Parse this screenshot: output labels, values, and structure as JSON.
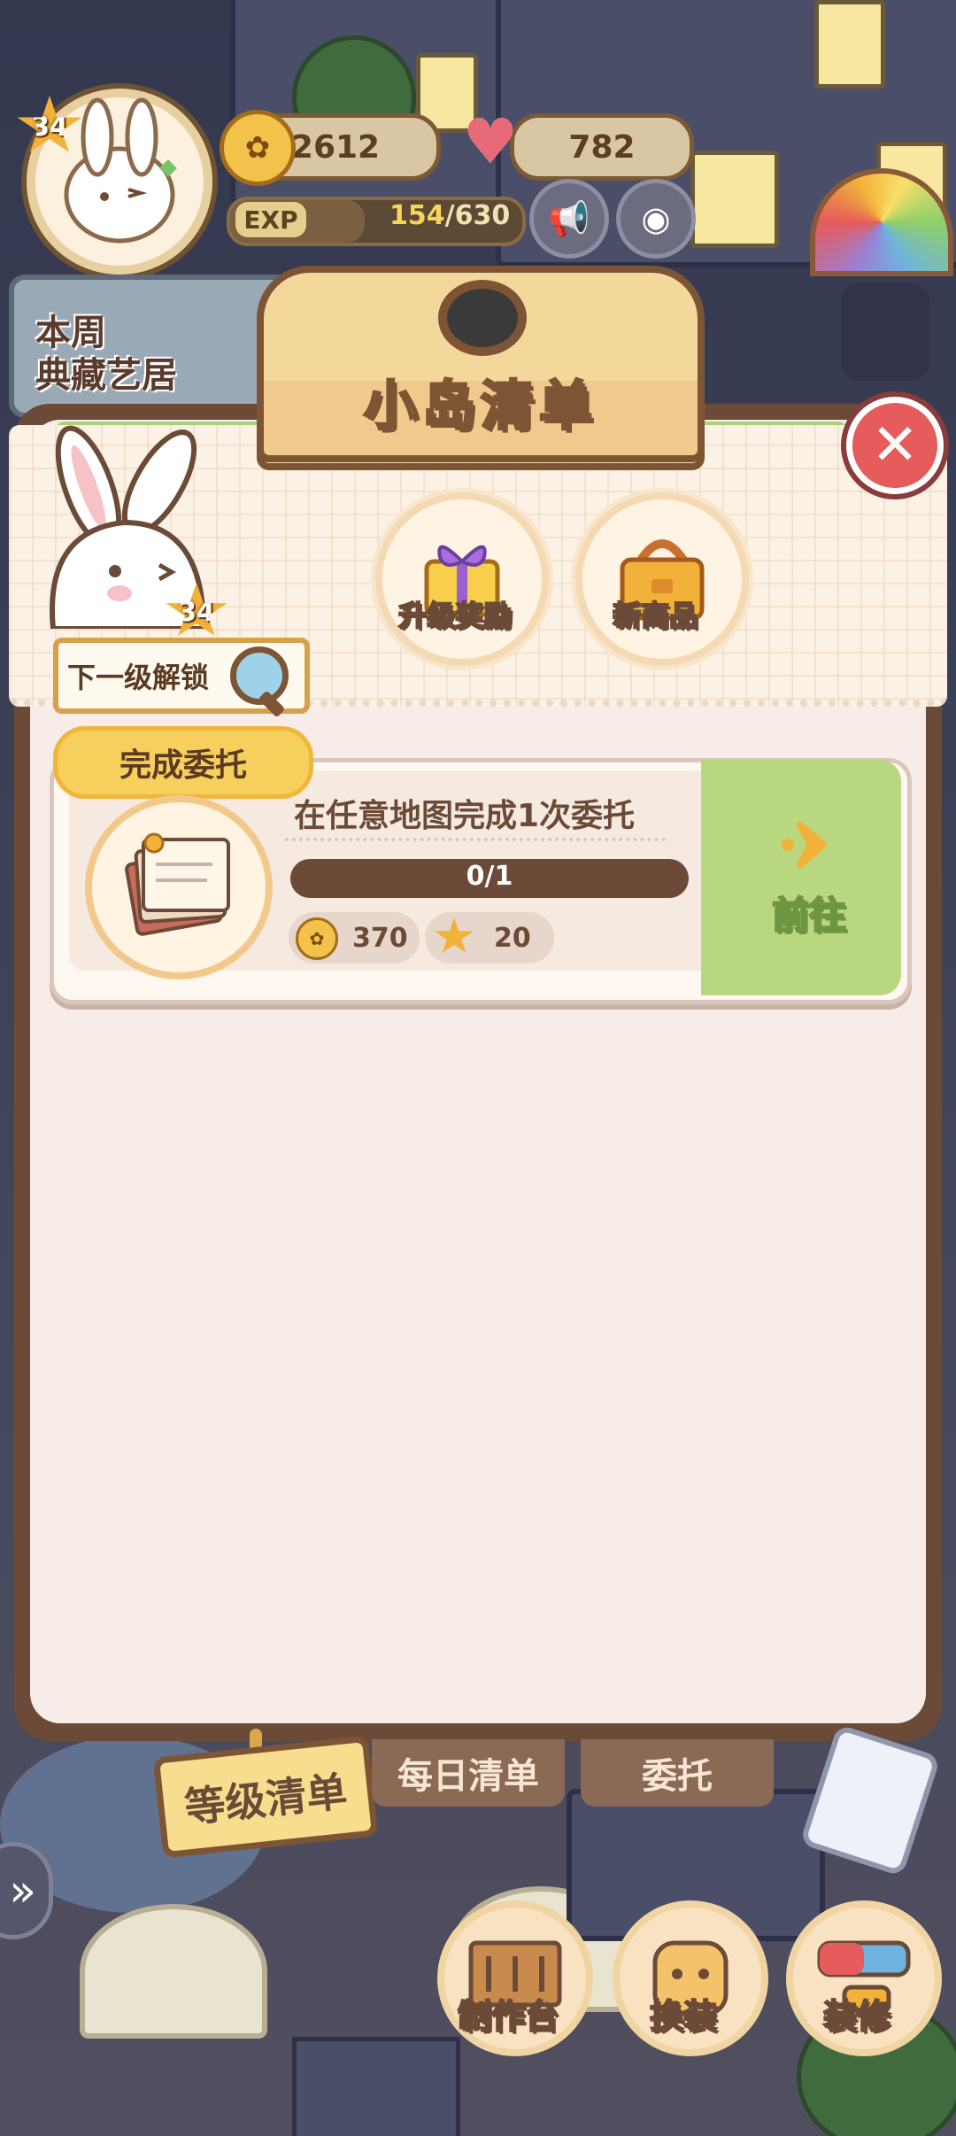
{
  "hud": {
    "player_level": "34",
    "coins": "2612",
    "hearts": "782",
    "exp_label": "EXP",
    "exp_current": "154",
    "exp_max": "/630",
    "weekly_banner_line1": "本周",
    "weekly_banner_line2": "典藏艺居"
  },
  "panel": {
    "title": "小岛清单",
    "close_icon": "close-icon",
    "next_unlock_label": "下一级解锁",
    "next_level": "34",
    "rewards": [
      {
        "label": "升级奖励",
        "icon": "gift-box-icon"
      },
      {
        "label": "新商品",
        "icon": "bag-icon"
      }
    ]
  },
  "task": {
    "category": "完成委托",
    "title": "在任意地图完成1次委托",
    "progress_text": "0/1",
    "progress": 0,
    "coin_reward": "370",
    "star_reward": "20",
    "go_label": "前往"
  },
  "tabs": {
    "level_list": "等级清单",
    "daily_list": "每日清单",
    "commission": "委托"
  },
  "bottom_nav": {
    "workbench": "制作台",
    "dress_up": "换装",
    "decorate": "装修"
  },
  "colors": {
    "panel_border": "#6b4a37",
    "panel_bg": "#f7ece7",
    "go_green": "#b9d77f",
    "close_red": "#e65b5b",
    "tag_yellow": "#f6cf5c"
  }
}
